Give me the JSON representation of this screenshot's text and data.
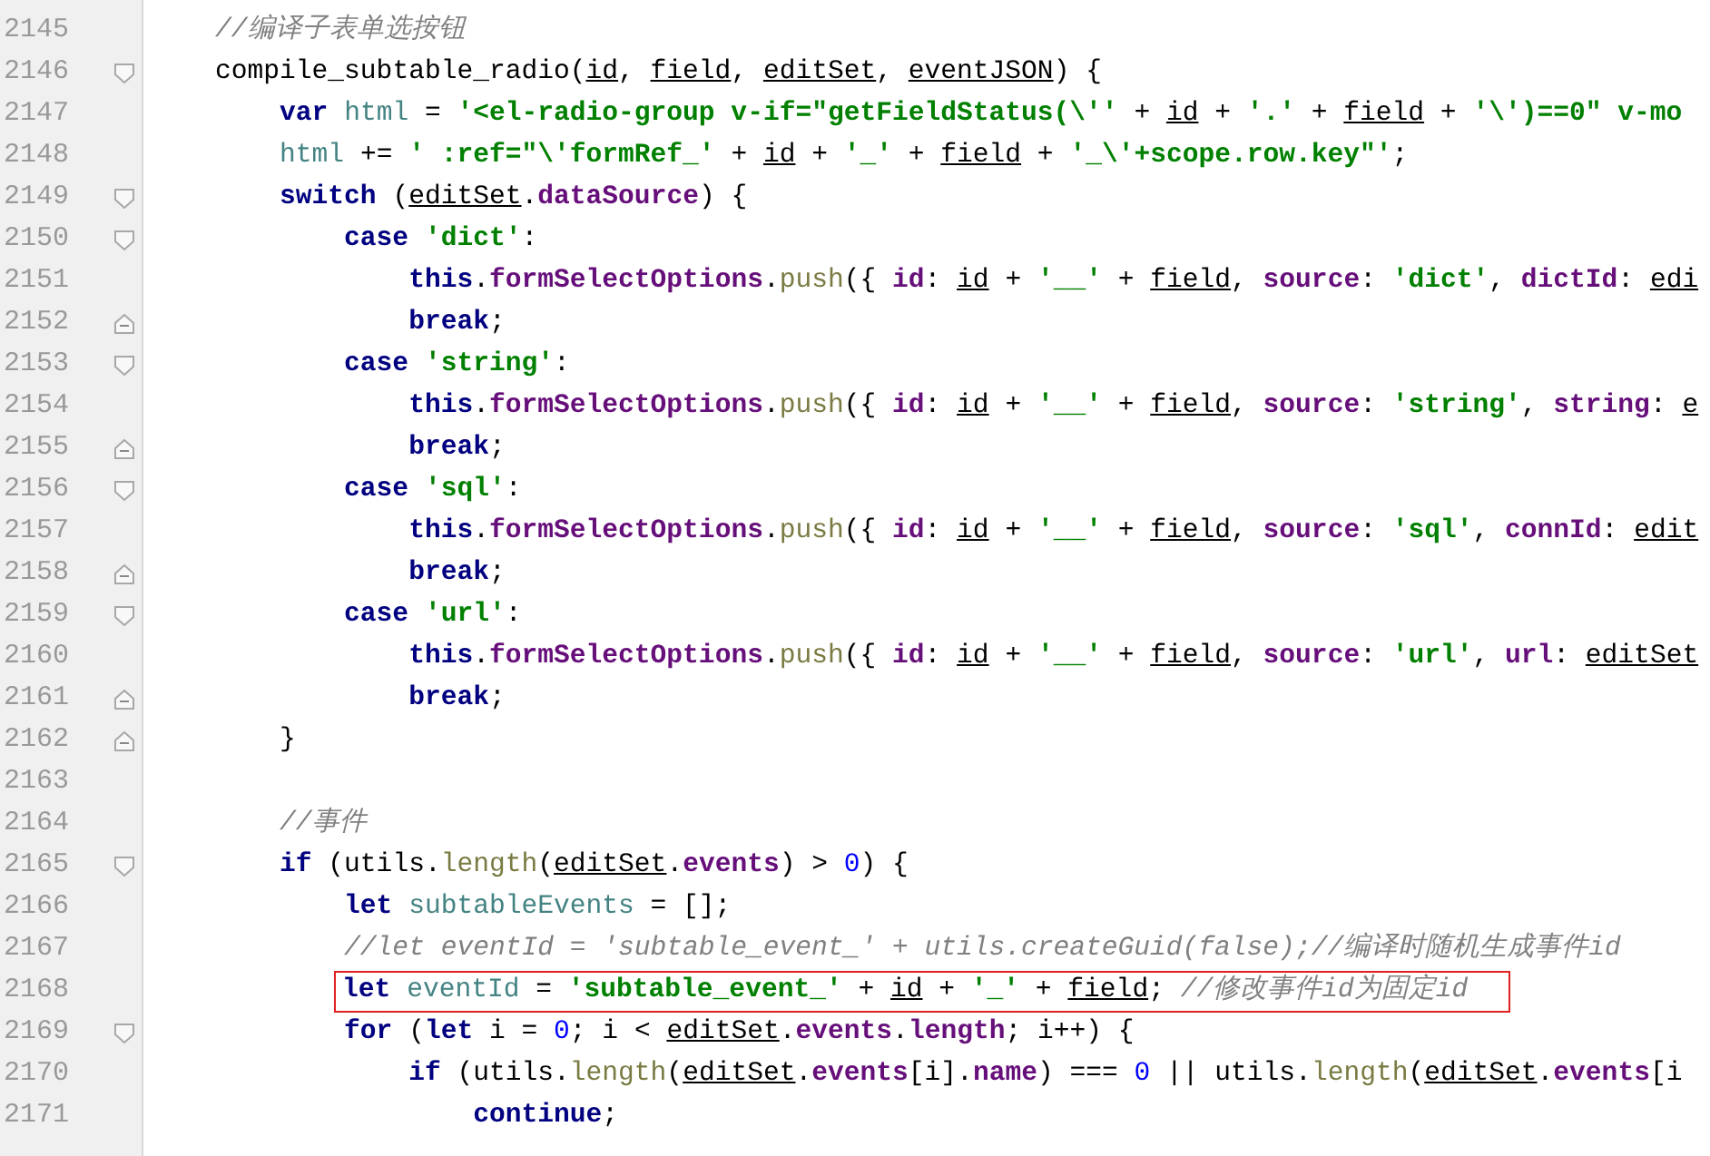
{
  "lines": [
    {
      "number": "2145",
      "highlighted": false,
      "tokens": [
        {
          "text": "//编译子表单选按钮",
          "kind": "com"
        }
      ]
    },
    {
      "number": "2146",
      "kind": "opener",
      "highlighted": false,
      "tokens": [
        {
          "text": "compile_subtable_radio(",
          "kind": "plain"
        },
        {
          "text": "id",
          "kind": "param"
        },
        {
          "text": ", ",
          "kind": "plain"
        },
        {
          "text": "field",
          "kind": "param"
        },
        {
          "text": ", ",
          "kind": "plain"
        },
        {
          "text": "editSet",
          "kind": "param"
        },
        {
          "text": ", ",
          "kind": "plain"
        },
        {
          "text": "eventJSON",
          "kind": "param"
        },
        {
          "text": ") {",
          "kind": "plain"
        }
      ],
      "children": [
        {
          "number": "2147",
          "highlighted": false,
          "tokens": [
            {
              "text": "var ",
              "kind": "kw"
            },
            {
              "text": "html",
              "kind": "local"
            },
            {
              "text": " = ",
              "kind": "plain"
            },
            {
              "text": "'<el-radio-group v-if=\"getFieldStatus(\\''",
              "kind": "str"
            },
            {
              "text": " + ",
              "kind": "plain"
            },
            {
              "text": "id",
              "kind": "param"
            },
            {
              "text": " + ",
              "kind": "plain"
            },
            {
              "text": "'.'",
              "kind": "str"
            },
            {
              "text": " + ",
              "kind": "plain"
            },
            {
              "text": "field",
              "kind": "param"
            },
            {
              "text": " + ",
              "kind": "plain"
            },
            {
              "text": "'\\')==0\" v-mo",
              "kind": "str"
            }
          ]
        },
        {
          "number": "2148",
          "highlighted": false,
          "tokens": [
            {
              "text": "html",
              "kind": "local"
            },
            {
              "text": " += ",
              "kind": "plain"
            },
            {
              "text": "' :ref=\"\\'formRef_'",
              "kind": "str"
            },
            {
              "text": " + ",
              "kind": "plain"
            },
            {
              "text": "id",
              "kind": "param"
            },
            {
              "text": " + ",
              "kind": "plain"
            },
            {
              "text": "'_'",
              "kind": "str"
            },
            {
              "text": " + ",
              "kind": "plain"
            },
            {
              "text": "field",
              "kind": "param"
            },
            {
              "text": " + ",
              "kind": "plain"
            },
            {
              "text": "'_\\'+scope.row.key\"'",
              "kind": "str"
            },
            {
              "text": ";",
              "kind": "plain"
            }
          ]
        },
        {
          "number": "2149",
          "kind": "opener",
          "highlighted": false,
          "tokens": [
            {
              "text": "switch ",
              "kind": "kw"
            },
            {
              "text": "(",
              "kind": "plain"
            },
            {
              "text": "editSet",
              "kind": "param"
            },
            {
              "text": ".",
              "kind": "plain"
            },
            {
              "text": "dataSource",
              "kind": "prop"
            },
            {
              "text": ") {",
              "kind": "plain"
            }
          ],
          "children": [
            {
              "number": "2150",
              "kind": "opener",
              "highlighted": false,
              "tokens": [
                {
                  "text": "case ",
                  "kind": "kw"
                },
                {
                  "text": "'dict'",
                  "kind": "str"
                },
                {
                  "text": ":",
                  "kind": "plain"
                }
              ],
              "children": [
                {
                  "number": "2151",
                  "highlighted": false,
                  "tokens": [
                    {
                      "text": "this",
                      "kind": "kw"
                    },
                    {
                      "text": ".",
                      "kind": "plain"
                    },
                    {
                      "text": "formSelectOptions",
                      "kind": "prop"
                    },
                    {
                      "text": ".",
                      "kind": "plain"
                    },
                    {
                      "text": "push",
                      "kind": "meth"
                    },
                    {
                      "text": "({ ",
                      "kind": "plain"
                    },
                    {
                      "text": "id",
                      "kind": "prop"
                    },
                    {
                      "text": ": ",
                      "kind": "plain"
                    },
                    {
                      "text": "id",
                      "kind": "param"
                    },
                    {
                      "text": " + ",
                      "kind": "plain"
                    },
                    {
                      "text": "'__'",
                      "kind": "str"
                    },
                    {
                      "text": " + ",
                      "kind": "plain"
                    },
                    {
                      "text": "field",
                      "kind": "param"
                    },
                    {
                      "text": ", ",
                      "kind": "plain"
                    },
                    {
                      "text": "source",
                      "kind": "prop"
                    },
                    {
                      "text": ": ",
                      "kind": "plain"
                    },
                    {
                      "text": "'dict'",
                      "kind": "str"
                    },
                    {
                      "text": ", ",
                      "kind": "plain"
                    },
                    {
                      "text": "dictId",
                      "kind": "prop"
                    },
                    {
                      "text": ": ",
                      "kind": "plain"
                    },
                    {
                      "text": "edi",
                      "kind": "param"
                    }
                  ]
                },
                {
                  "number": "2152",
                  "kind": "closer",
                  "highlighted": false,
                  "tokens": [
                    {
                      "text": "break",
                      "kind": "kw"
                    },
                    {
                      "text": ";",
                      "kind": "plain"
                    }
                  ]
                }
              ]
            },
            {
              "number": "2153",
              "kind": "opener",
              "highlighted": false,
              "tokens": [
                {
                  "text": "case ",
                  "kind": "kw"
                },
                {
                  "text": "'string'",
                  "kind": "str"
                },
                {
                  "text": ":",
                  "kind": "plain"
                }
              ],
              "children": [
                {
                  "number": "2154",
                  "highlighted": false,
                  "tokens": [
                    {
                      "text": "this",
                      "kind": "kw"
                    },
                    {
                      "text": ".",
                      "kind": "plain"
                    },
                    {
                      "text": "formSelectOptions",
                      "kind": "prop"
                    },
                    {
                      "text": ".",
                      "kind": "plain"
                    },
                    {
                      "text": "push",
                      "kind": "meth"
                    },
                    {
                      "text": "({ ",
                      "kind": "plain"
                    },
                    {
                      "text": "id",
                      "kind": "prop"
                    },
                    {
                      "text": ": ",
                      "kind": "plain"
                    },
                    {
                      "text": "id",
                      "kind": "param"
                    },
                    {
                      "text": " + ",
                      "kind": "plain"
                    },
                    {
                      "text": "'__'",
                      "kind": "str"
                    },
                    {
                      "text": " + ",
                      "kind": "plain"
                    },
                    {
                      "text": "field",
                      "kind": "param"
                    },
                    {
                      "text": ", ",
                      "kind": "plain"
                    },
                    {
                      "text": "source",
                      "kind": "prop"
                    },
                    {
                      "text": ": ",
                      "kind": "plain"
                    },
                    {
                      "text": "'string'",
                      "kind": "str"
                    },
                    {
                      "text": ", ",
                      "kind": "plain"
                    },
                    {
                      "text": "string",
                      "kind": "prop"
                    },
                    {
                      "text": ": ",
                      "kind": "plain"
                    },
                    {
                      "text": "e",
                      "kind": "param"
                    }
                  ]
                },
                {
                  "number": "2155",
                  "kind": "closer",
                  "highlighted": false,
                  "tokens": [
                    {
                      "text": "break",
                      "kind": "kw"
                    },
                    {
                      "text": ";",
                      "kind": "plain"
                    }
                  ]
                }
              ]
            },
            {
              "number": "2156",
              "kind": "opener",
              "highlighted": false,
              "tokens": [
                {
                  "text": "case ",
                  "kind": "kw"
                },
                {
                  "text": "'sql'",
                  "kind": "str"
                },
                {
                  "text": ":",
                  "kind": "plain"
                }
              ],
              "children": [
                {
                  "number": "2157",
                  "highlighted": false,
                  "tokens": [
                    {
                      "text": "this",
                      "kind": "kw"
                    },
                    {
                      "text": ".",
                      "kind": "plain"
                    },
                    {
                      "text": "formSelectOptions",
                      "kind": "prop"
                    },
                    {
                      "text": ".",
                      "kind": "plain"
                    },
                    {
                      "text": "push",
                      "kind": "meth"
                    },
                    {
                      "text": "({ ",
                      "kind": "plain"
                    },
                    {
                      "text": "id",
                      "kind": "prop"
                    },
                    {
                      "text": ": ",
                      "kind": "plain"
                    },
                    {
                      "text": "id",
                      "kind": "param"
                    },
                    {
                      "text": " + ",
                      "kind": "plain"
                    },
                    {
                      "text": "'__'",
                      "kind": "str"
                    },
                    {
                      "text": " + ",
                      "kind": "plain"
                    },
                    {
                      "text": "field",
                      "kind": "param"
                    },
                    {
                      "text": ", ",
                      "kind": "plain"
                    },
                    {
                      "text": "source",
                      "kind": "prop"
                    },
                    {
                      "text": ": ",
                      "kind": "plain"
                    },
                    {
                      "text": "'sql'",
                      "kind": "str"
                    },
                    {
                      "text": ", ",
                      "kind": "plain"
                    },
                    {
                      "text": "connId",
                      "kind": "prop"
                    },
                    {
                      "text": ": ",
                      "kind": "plain"
                    },
                    {
                      "text": "edit",
                      "kind": "param"
                    }
                  ]
                },
                {
                  "number": "2158",
                  "kind": "closer",
                  "highlighted": false,
                  "tokens": [
                    {
                      "text": "break",
                      "kind": "kw"
                    },
                    {
                      "text": ";",
                      "kind": "plain"
                    }
                  ]
                }
              ]
            },
            {
              "number": "2159",
              "kind": "opener",
              "highlighted": false,
              "tokens": [
                {
                  "text": "case ",
                  "kind": "kw"
                },
                {
                  "text": "'url'",
                  "kind": "str"
                },
                {
                  "text": ":",
                  "kind": "plain"
                }
              ],
              "children": [
                {
                  "number": "2160",
                  "highlighted": false,
                  "tokens": [
                    {
                      "text": "this",
                      "kind": "kw"
                    },
                    {
                      "text": ".",
                      "kind": "plain"
                    },
                    {
                      "text": "formSelectOptions",
                      "kind": "prop"
                    },
                    {
                      "text": ".",
                      "kind": "plain"
                    },
                    {
                      "text": "push",
                      "kind": "meth"
                    },
                    {
                      "text": "({ ",
                      "kind": "plain"
                    },
                    {
                      "text": "id",
                      "kind": "prop"
                    },
                    {
                      "text": ": ",
                      "kind": "plain"
                    },
                    {
                      "text": "id",
                      "kind": "param"
                    },
                    {
                      "text": " + ",
                      "kind": "plain"
                    },
                    {
                      "text": "'__'",
                      "kind": "str"
                    },
                    {
                      "text": " + ",
                      "kind": "plain"
                    },
                    {
                      "text": "field",
                      "kind": "param"
                    },
                    {
                      "text": ", ",
                      "kind": "plain"
                    },
                    {
                      "text": "source",
                      "kind": "prop"
                    },
                    {
                      "text": ": ",
                      "kind": "plain"
                    },
                    {
                      "text": "'url'",
                      "kind": "str"
                    },
                    {
                      "text": ", ",
                      "kind": "plain"
                    },
                    {
                      "text": "url",
                      "kind": "prop"
                    },
                    {
                      "text": ": ",
                      "kind": "plain"
                    },
                    {
                      "text": "editSet",
                      "kind": "param"
                    }
                  ]
                },
                {
                  "number": "2161",
                  "kind": "closer",
                  "highlighted": false,
                  "tokens": [
                    {
                      "text": "break",
                      "kind": "kw"
                    },
                    {
                      "text": ";",
                      "kind": "plain"
                    }
                  ]
                }
              ]
            }
          ]
        },
        {
          "number": "2162",
          "kind": "closer",
          "highlighted": false,
          "tokens": [
            {
              "text": "}",
              "kind": "plain"
            }
          ]
        },
        {
          "number": "2163"
        },
        {
          "number": "2164",
          "highlighted": false,
          "tokens": [
            {
              "text": "//事件",
              "kind": "com"
            }
          ]
        },
        {
          "number": "2165",
          "kind": "opener",
          "highlighted": false,
          "tokens": [
            {
              "text": "if ",
              "kind": "kw"
            },
            {
              "text": "(utils.",
              "kind": "plain"
            },
            {
              "text": "length",
              "kind": "meth"
            },
            {
              "text": "(",
              "kind": "plain"
            },
            {
              "text": "editSet",
              "kind": "param"
            },
            {
              "text": ".",
              "kind": "plain"
            },
            {
              "text": "events",
              "kind": "prop"
            },
            {
              "text": ") > ",
              "kind": "plain"
            },
            {
              "text": "0",
              "kind": "num"
            },
            {
              "text": ") {",
              "kind": "plain"
            }
          ],
          "children": [
            {
              "number": "2166",
              "highlighted": false,
              "tokens": [
                {
                  "text": "let ",
                  "kind": "kw"
                },
                {
                  "text": "subtableEvents",
                  "kind": "local"
                },
                {
                  "text": " = [];",
                  "kind": "plain"
                }
              ]
            },
            {
              "number": "2167",
              "highlighted": false,
              "tokens": [
                {
                  "text": "//let eventId = 'subtable_event_' + utils.createGuid(false);//编译时随机生成事件id",
                  "kind": "com"
                }
              ]
            },
            {
              "number": "2168",
              "highlighted": true,
              "tokens": [
                {
                  "text": "let ",
                  "kind": "kw"
                },
                {
                  "text": "eventId",
                  "kind": "local"
                },
                {
                  "text": " = ",
                  "kind": "plain"
                },
                {
                  "text": "'subtable_event_'",
                  "kind": "str"
                },
                {
                  "text": " + ",
                  "kind": "plain"
                },
                {
                  "text": "id",
                  "kind": "param"
                },
                {
                  "text": " + ",
                  "kind": "plain"
                },
                {
                  "text": "'_'",
                  "kind": "str"
                },
                {
                  "text": " + ",
                  "kind": "plain"
                },
                {
                  "text": "field",
                  "kind": "param"
                },
                {
                  "text": "; ",
                  "kind": "plain"
                },
                {
                  "text": "//修改事件id为固定id",
                  "kind": "com"
                }
              ]
            },
            {
              "number": "2169",
              "kind": "opener",
              "highlighted": false,
              "tokens": [
                {
                  "text": "for ",
                  "kind": "kw"
                },
                {
                  "text": "(",
                  "kind": "plain"
                },
                {
                  "text": "let ",
                  "kind": "kw"
                },
                {
                  "text": "i = ",
                  "kind": "plain"
                },
                {
                  "text": "0",
                  "kind": "num"
                },
                {
                  "text": "; i < ",
                  "kind": "plain"
                },
                {
                  "text": "editSet",
                  "kind": "param"
                },
                {
                  "text": ".",
                  "kind": "plain"
                },
                {
                  "text": "events",
                  "kind": "prop"
                },
                {
                  "text": ".",
                  "kind": "plain"
                },
                {
                  "text": "length",
                  "kind": "prop"
                },
                {
                  "text": "; i++) {",
                  "kind": "plain"
                }
              ],
              "children": [
                {
                  "number": "2170",
                  "highlighted": false,
                  "tokens": [
                    {
                      "text": "if ",
                      "kind": "kw"
                    },
                    {
                      "text": "(utils.",
                      "kind": "plain"
                    },
                    {
                      "text": "length",
                      "kind": "meth"
                    },
                    {
                      "text": "(",
                      "kind": "plain"
                    },
                    {
                      "text": "editSet",
                      "kind": "param"
                    },
                    {
                      "text": ".",
                      "kind": "plain"
                    },
                    {
                      "text": "events",
                      "kind": "prop"
                    },
                    {
                      "text": "[i].",
                      "kind": "plain"
                    },
                    {
                      "text": "name",
                      "kind": "prop"
                    },
                    {
                      "text": ") === ",
                      "kind": "plain"
                    },
                    {
                      "text": "0",
                      "kind": "num"
                    },
                    {
                      "text": " || utils.",
                      "kind": "plain"
                    },
                    {
                      "text": "length",
                      "kind": "meth"
                    },
                    {
                      "text": "(",
                      "kind": "plain"
                    },
                    {
                      "text": "editSet",
                      "kind": "param"
                    },
                    {
                      "text": ".",
                      "kind": "plain"
                    },
                    {
                      "text": "events",
                      "kind": "prop"
                    },
                    {
                      "text": "[i",
                      "kind": "plain"
                    }
                  ],
                  "children": [
                    {
                      "number": "2171",
                      "highlighted": false,
                      "tokens": [
                        {
                          "text": "continue",
                          "kind": "kw"
                        },
                        {
                          "text": ";",
                          "kind": "plain"
                        }
                      ]
                    }
                  ]
                }
              ]
            }
          ]
        }
      ]
    }
  ]
}
